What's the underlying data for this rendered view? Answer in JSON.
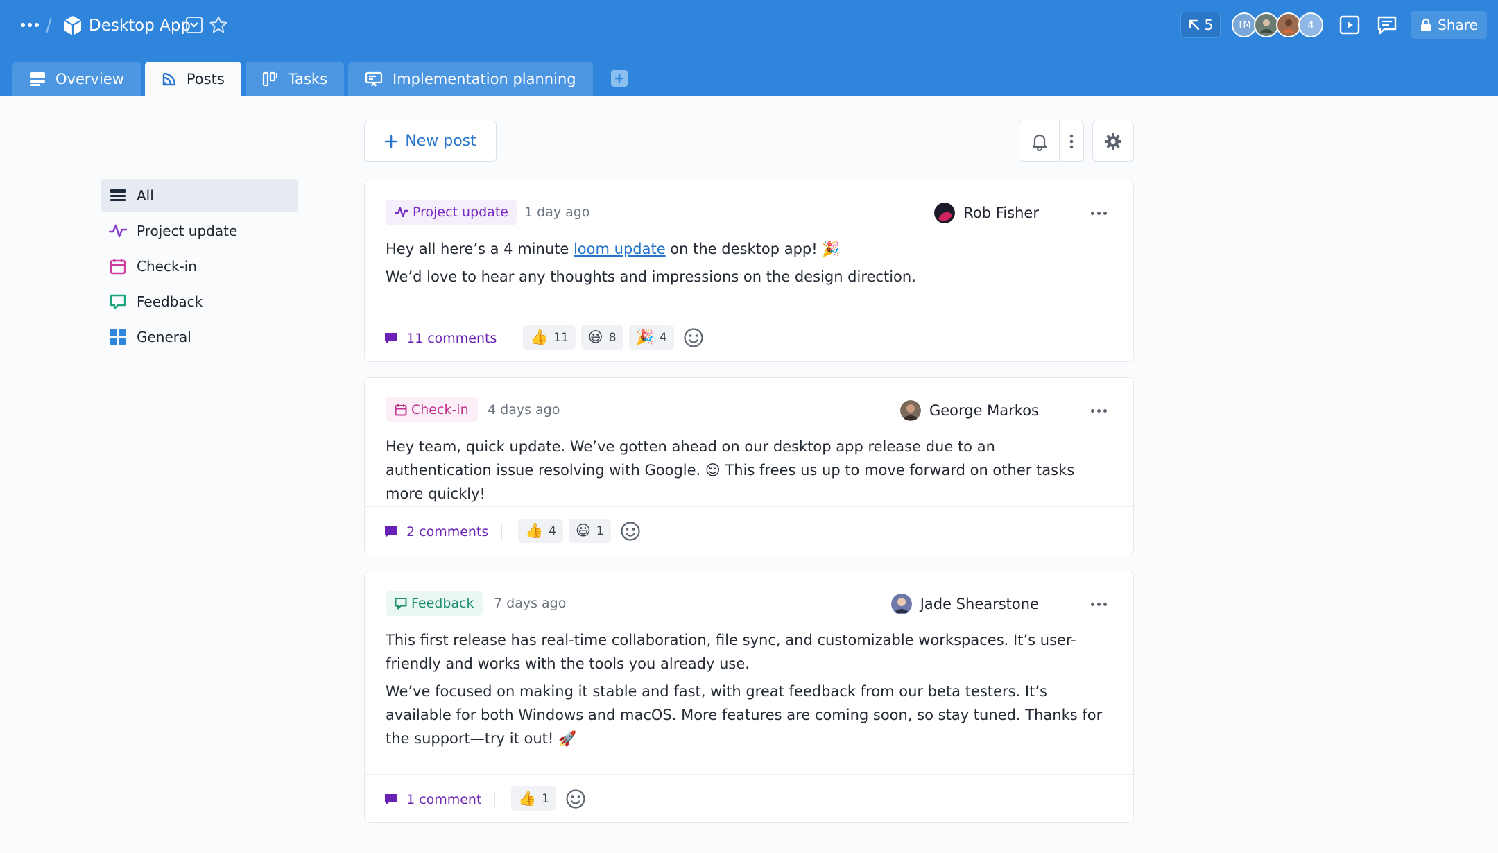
{
  "header": {
    "app_title": "Desktop App",
    "cursor_count": "5",
    "avatars": {
      "initials": "TM",
      "more_count": "4"
    },
    "share_label": "Share",
    "colors": {
      "bar": "#2f84db",
      "accent": "#2876cc"
    }
  },
  "tabs": [
    {
      "label": "Overview",
      "icon": "overview-icon"
    },
    {
      "label": "Posts",
      "icon": "rss-icon",
      "active": true
    },
    {
      "label": "Tasks",
      "icon": "board-icon"
    },
    {
      "label": "Implementation planning",
      "icon": "whiteboard-icon"
    }
  ],
  "sidebar": {
    "items": [
      {
        "label": "All",
        "icon": "list-icon",
        "active": true
      },
      {
        "label": "Project update",
        "icon": "activity-icon"
      },
      {
        "label": "Check-in",
        "icon": "calendar-icon"
      },
      {
        "label": "Feedback",
        "icon": "chat-bubble-icon"
      },
      {
        "label": "General",
        "icon": "grid-icon"
      }
    ]
  },
  "toolbar": {
    "new_post_label": "New post"
  },
  "posts": [
    {
      "tag": "Project update",
      "time": "1 day ago",
      "author": "Rob Fisher",
      "body": {
        "l1_pre": "Hey all here’s a 4 minute ",
        "l1_link": "loom update",
        "l1_post": " on the desktop app! ",
        "l1_emoji": "🎉",
        "l2": "We’d love to hear any thoughts and impressions on the design direction."
      },
      "comments": "11 comments",
      "reactions": [
        {
          "emoji": "👍",
          "count": "11"
        },
        {
          "emoji": "😃",
          "count": "8"
        },
        {
          "emoji": "🎉",
          "count": "4"
        }
      ]
    },
    {
      "tag": "Check-in",
      "time": "4 days ago",
      "author": "George Markos",
      "body": {
        "l1": "Hey team, quick update. We’ve gotten ahead on our desktop app release due to an authentication issue resolving with Google. ",
        "l1_emoji": "😌",
        "l1_post": " This frees us up to move forward on other tasks more quickly!"
      },
      "comments": "2 comments",
      "reactions": [
        {
          "emoji": "👍",
          "count": "4"
        },
        {
          "emoji": "😃",
          "count": "1"
        }
      ]
    },
    {
      "tag": "Feedback",
      "time": "7 days ago",
      "author": "Jade Shearstone",
      "body": {
        "p1": "This first release has real-time collaboration, file sync, and customizable workspaces. It’s user-friendly and works with the tools you already use.",
        "p2": "We’ve focused on making it stable and fast, with great feedback from our beta testers. It’s available for both Windows and macOS. More features are coming soon, so stay tuned. Thanks for the support—try it out! ",
        "p2_emoji": "🚀"
      },
      "comments": "1 comment",
      "reactions": [
        {
          "emoji": "👍",
          "count": "1"
        }
      ]
    }
  ]
}
